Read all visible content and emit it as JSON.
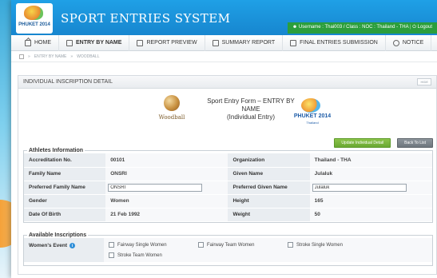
{
  "app": {
    "title": "SPORT ENTRIES SYSTEM",
    "logo_text": "PHUKET 2014",
    "user_info": "Username : Thai003 / Class : NOC : Thailand - THA",
    "logout": "Logout"
  },
  "menu": [
    {
      "label": "HOME",
      "icon": "home-icon"
    },
    {
      "label": "ENTRY BY NAME",
      "icon": "entry-icon",
      "active": true
    },
    {
      "label": "REPORT PREVIEW",
      "icon": "document-icon"
    },
    {
      "label": "SUMMARY REPORT",
      "icon": "document-icon"
    },
    {
      "label": "FINAL ENTRIES SUBMISSION",
      "icon": "document-icon"
    },
    {
      "label": "NOTICE",
      "icon": "info-icon"
    }
  ],
  "breadcrumb": [
    "ENTRY BY NAME",
    "WOODBALL"
  ],
  "panel": {
    "title": "INDIVIDUAL INSCRIPTION DETAIL",
    "hide_label": "HIDE"
  },
  "form": {
    "sport_name": "Woodball",
    "title_line1": "Sport Entry Form – ENTRY BY NAME",
    "title_line2": "(Individual Entry)",
    "event_logo_text": "PHUKET 2014",
    "event_logo_sub": "Thailand"
  },
  "buttons": {
    "update": "Update Individual Detail",
    "back": "Back To List"
  },
  "athletes": {
    "legend": "Athletes Information",
    "rows": [
      {
        "l1": "Accreditation No.",
        "v1": "00101",
        "l2": "Organization",
        "v2": "Thailand - THA"
      },
      {
        "l1": "Family Name",
        "v1": "ONSRI",
        "l2": "Given Name",
        "v2": "Julaluk"
      },
      {
        "l1": "Preferred Family Name",
        "v1": "ONSRI",
        "l2": "Preferred Given Name",
        "v2": "Julaluk"
      },
      {
        "l1": "Gender",
        "v1": "Women",
        "l2": "Height",
        "v2": "165"
      },
      {
        "l1": "Date Of Birth",
        "v1": "21 Feb 1992",
        "l2": "Weight",
        "v2": "50"
      }
    ]
  },
  "inscriptions": {
    "legend": "Available Inscriptions",
    "label": "Women's Event",
    "options": [
      "Fairway Single Women",
      "Fairway Team Women",
      "Stroke Single Women",
      "Stroke Team Women"
    ]
  }
}
